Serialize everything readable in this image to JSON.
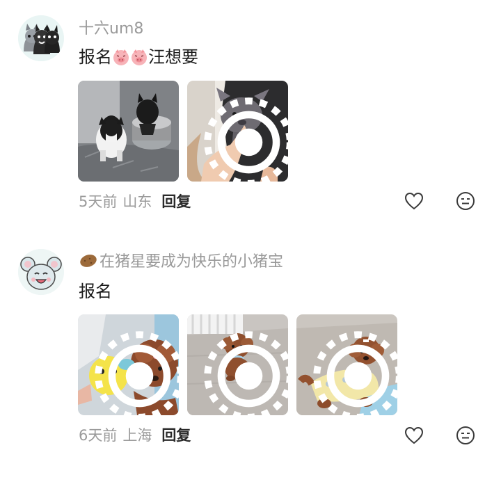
{
  "comments": [
    {
      "username": "十六um8",
      "text_before": "报名",
      "emoji_count": 2,
      "text_after": "汪想要",
      "time": "5天前",
      "location": "山东",
      "reply_label": "回复",
      "images": [
        {
          "kind": "photo",
          "live": false
        },
        {
          "kind": "photo",
          "live": true
        }
      ]
    },
    {
      "username_icon": "potato-icon",
      "username": "在猪星要成为快乐的小猪宝",
      "text": "报名",
      "time": "6天前",
      "location": "上海",
      "reply_label": "回复",
      "images": [
        {
          "kind": "photo",
          "live": true
        },
        {
          "kind": "photo",
          "live": true
        },
        {
          "kind": "photo",
          "live": true
        }
      ]
    }
  ],
  "icons": {
    "like": "heart-outline-icon",
    "react": "smiley-face-icon",
    "live": "live-photo-icon"
  },
  "colors": {
    "username": "#9a9a9a",
    "body_text": "#1b1b1b",
    "meta": "#9a9a9a",
    "reply": "#2a2a2a"
  }
}
